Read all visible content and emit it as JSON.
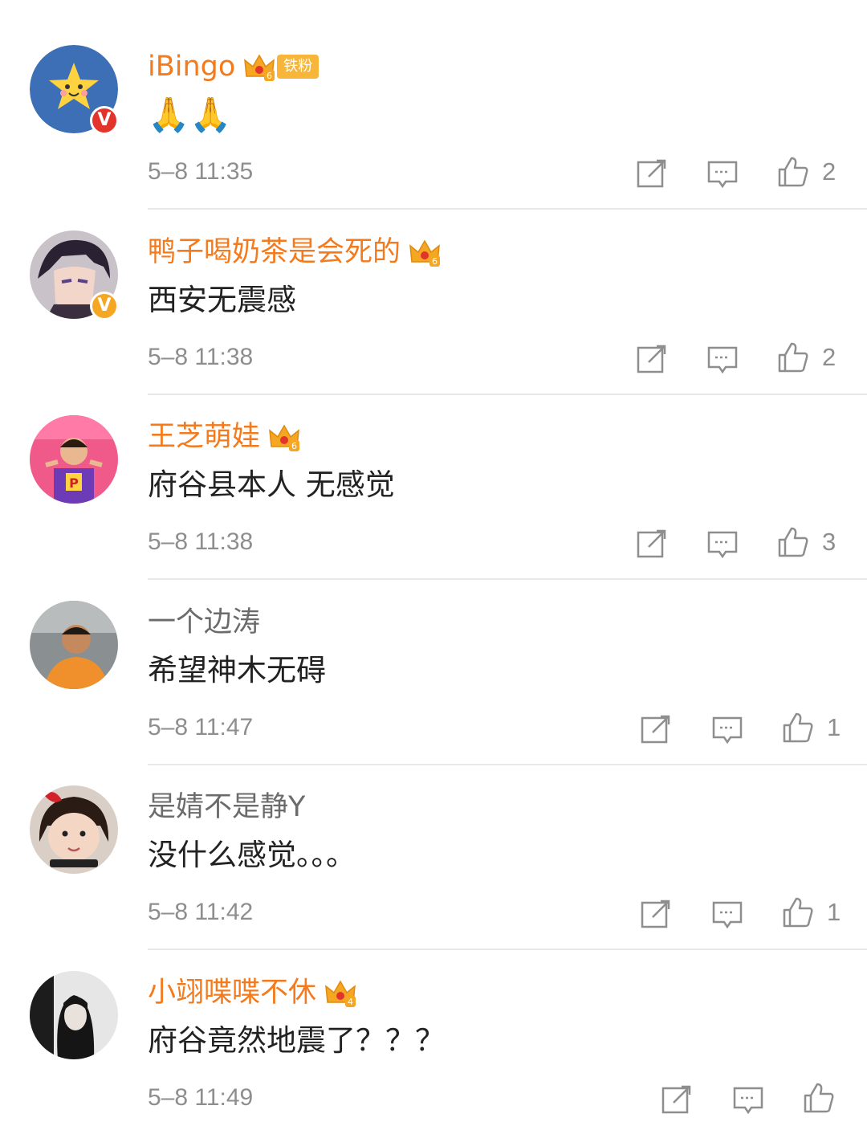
{
  "status_partial": "",
  "comments": [
    {
      "username": "iBingo",
      "user_style": "vip",
      "crown_level": "6",
      "fan_badge": "铁粉",
      "verified": "red",
      "content": "🙏🙏",
      "time": "5–8 11:35",
      "likes": "2"
    },
    {
      "username": "鸭子喝奶茶是会死的",
      "user_style": "vip",
      "crown_level": "6",
      "verified": "gold",
      "content": "西安无震感",
      "time": "5–8 11:38",
      "likes": "2"
    },
    {
      "username": "王芝萌娃",
      "user_style": "vip",
      "crown_level": "6",
      "content": "府谷县本人 无感觉",
      "time": "5–8 11:38",
      "likes": "3"
    },
    {
      "username": "一个边涛",
      "user_style": "plain",
      "content": "希望神木无碍",
      "time": "5–8 11:47",
      "likes": "1"
    },
    {
      "username": "是婧不是静Y",
      "user_style": "plain",
      "content": "没什么感觉。。。",
      "time": "5–8 11:42",
      "likes": "1"
    },
    {
      "username": "小翊喋喋不休",
      "user_style": "vip",
      "crown_level": "4",
      "content": "府谷竟然地震了？？？",
      "time": "5–8 11:49",
      "likes": ""
    }
  ],
  "icons": {
    "share": "share-icon",
    "comment": "comment-icon",
    "like": "thumbs-up-icon",
    "crown": "crown-icon"
  },
  "colors": {
    "vip_name": "#f37b1d",
    "plain_name": "#6b6b6b",
    "text": "#222222",
    "meta": "#8e8e8e"
  }
}
